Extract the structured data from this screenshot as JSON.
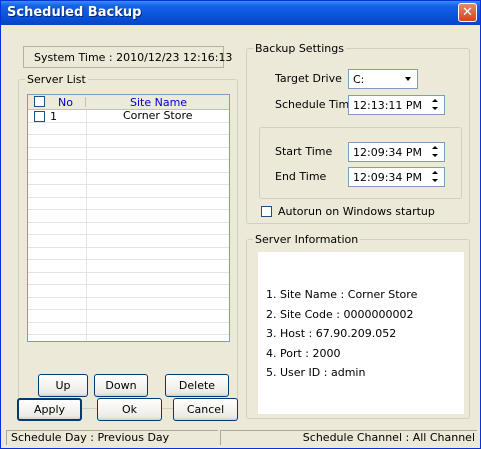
{
  "window": {
    "title": "Scheduled Backup",
    "close_glyph": "✕"
  },
  "system_time": "System Time : 2010/12/23 12:16:13",
  "server_list": {
    "group_label": "Server List",
    "columns": {
      "no": "No",
      "site_name": "Site Name"
    },
    "rows": [
      {
        "no": "1",
        "site_name": "Corner Store",
        "checked": false
      }
    ],
    "buttons": {
      "up": "Up",
      "down": "Down",
      "delete": "Delete"
    }
  },
  "backup_settings": {
    "group_label": "Backup Settings",
    "target_drive_label": "Target Drive",
    "target_drive_value": "C:",
    "schedule_time_label": "Schedule Time",
    "schedule_time_value": "12:13:11 PM",
    "start_time_label": "Start Time",
    "start_time_value": "12:09:34 PM",
    "end_time_label": "End Time",
    "end_time_value": "12:09:34 PM",
    "autorun_label": "Autorun on Windows startup",
    "autorun_checked": false
  },
  "server_information": {
    "group_label": "Server Information",
    "lines": [
      "1. Site Name : Corner Store",
      "2. Site Code : 0000000002",
      "3. Host : 67.90.209.052",
      "4. Port : 2000",
      "5. User ID : admin"
    ]
  },
  "actions": {
    "apply": "Apply",
    "ok": "Ok",
    "cancel": "Cancel"
  },
  "status": {
    "schedule_day": "Schedule Day : Previous Day",
    "schedule_channel": "Schedule Channel : All Channel"
  },
  "colors": {
    "title_bar": "#0a54dc",
    "header_text": "#0000cc",
    "face": "#ece9d8"
  }
}
